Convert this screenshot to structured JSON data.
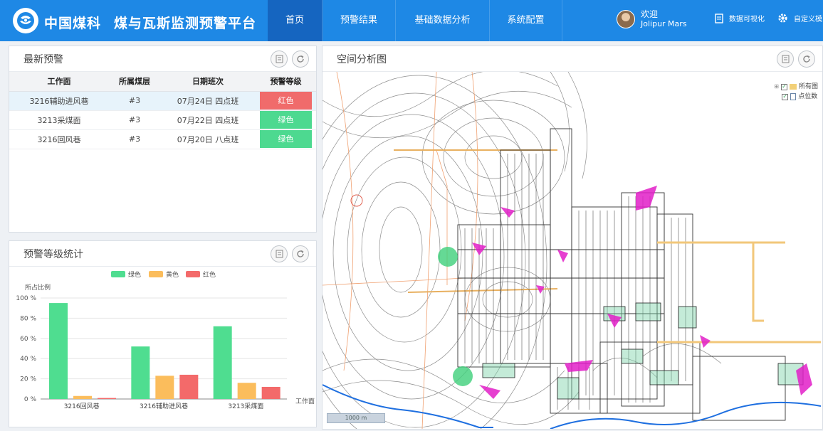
{
  "brand": "中国煤科",
  "app_title": "煤与瓦斯监测预警平台",
  "nav": [
    {
      "label": "首页",
      "active": true
    },
    {
      "label": "预警结果",
      "active": false
    },
    {
      "label": "基础数据分析",
      "active": false
    },
    {
      "label": "系统配置",
      "active": false
    }
  ],
  "user": {
    "welcome": "欢迎",
    "name": "Jolipur Mars"
  },
  "header_links": {
    "dataviz": "数据可视化",
    "custom": "自定义模"
  },
  "alerts_panel": {
    "title": "最新预警",
    "columns": [
      "工作面",
      "所属煤层",
      "日期班次",
      "预警等级"
    ],
    "rows": [
      {
        "face": "3216辅助进风巷",
        "seam": "#3",
        "shift": "07月24日 四点班",
        "level": "红色",
        "color": "#f06b6b",
        "selected": true
      },
      {
        "face": "3213采煤面",
        "seam": "#3",
        "shift": "07月22日 四点班",
        "level": "绿色",
        "color": "#4dd990",
        "selected": false
      },
      {
        "face": "3216回风巷",
        "seam": "#3",
        "shift": "07月20日 八点班",
        "level": "绿色",
        "color": "#4dd990",
        "selected": false
      }
    ]
  },
  "stats_panel": {
    "title": "预警等级统计"
  },
  "chart_data": {
    "type": "bar",
    "categories": [
      "3216回风巷",
      "3216辅助进风巷",
      "3213采煤面"
    ],
    "series": [
      {
        "name": "绿色",
        "color": "#4fdd90",
        "values": [
          95,
          52,
          72
        ]
      },
      {
        "name": "黄色",
        "color": "#fbbd5c",
        "values": [
          3,
          23,
          16
        ]
      },
      {
        "name": "红色",
        "color": "#f36a6a",
        "values": [
          1,
          24,
          12
        ]
      }
    ],
    "ylabel": "所占比例",
    "xlabel": "工作面",
    "ylim": [
      0,
      100
    ],
    "yticks": [
      "0 %",
      "20 %",
      "40 %",
      "60 %",
      "80 %",
      "100 %"
    ],
    "legend_position": "top",
    "grid": true
  },
  "map_panel": {
    "title": "空间分析图",
    "layers": [
      "所有图",
      "点位数"
    ],
    "scale": "1000 m"
  },
  "colors": {
    "header": "#1e88e5",
    "nav_active": "#1565c0",
    "map_green": "#3fd07a",
    "map_magenta": "#e21fc8"
  }
}
